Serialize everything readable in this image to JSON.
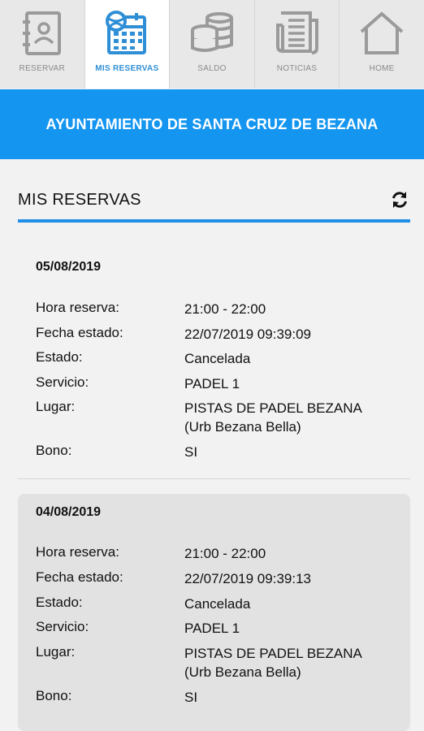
{
  "tabs": [
    {
      "label": "RESERVAR",
      "icon": "address-book-icon",
      "active": false
    },
    {
      "label": "MIS RESERVAS",
      "icon": "calendar-icon",
      "active": true
    },
    {
      "label": "SALDO",
      "icon": "coins-icon",
      "active": false
    },
    {
      "label": "NOTICIAS",
      "icon": "newspaper-icon",
      "active": false
    },
    {
      "label": "HOME",
      "icon": "home-icon",
      "active": false
    }
  ],
  "banner": {
    "title": "AYUNTAMIENTO DE SANTA CRUZ DE BEZANA"
  },
  "section": {
    "title": "MIS RESERVAS",
    "refresh_icon": "refresh-icon"
  },
  "labels": {
    "hora": "Hora reserva:",
    "fecha_estado": "Fecha estado:",
    "estado": "Estado:",
    "servicio": "Servicio:",
    "lugar": "Lugar:",
    "bono": "Bono:"
  },
  "reservations": [
    {
      "date": "05/08/2019",
      "hora": "21:00 - 22:00",
      "fecha_estado": "22/07/2019 09:39:09",
      "estado": "Cancelada",
      "servicio": "PADEL 1",
      "lugar_1": "PISTAS DE PADEL BEZANA",
      "lugar_2": "(Urb Bezana Bella)",
      "bono": "SI"
    },
    {
      "date": "04/08/2019",
      "hora": "21:00 - 22:00",
      "fecha_estado": "22/07/2019 09:39:13",
      "estado": "Cancelada",
      "servicio": "PADEL 1",
      "lugar_1": "PISTAS DE PADEL BEZANA",
      "lugar_2": "(Urb Bezana Bella)",
      "bono": "SI"
    }
  ],
  "colors": {
    "accent": "#1495f0",
    "active_tab_label": "#2f8fd6",
    "icon_gray": "#9a9a9a"
  }
}
